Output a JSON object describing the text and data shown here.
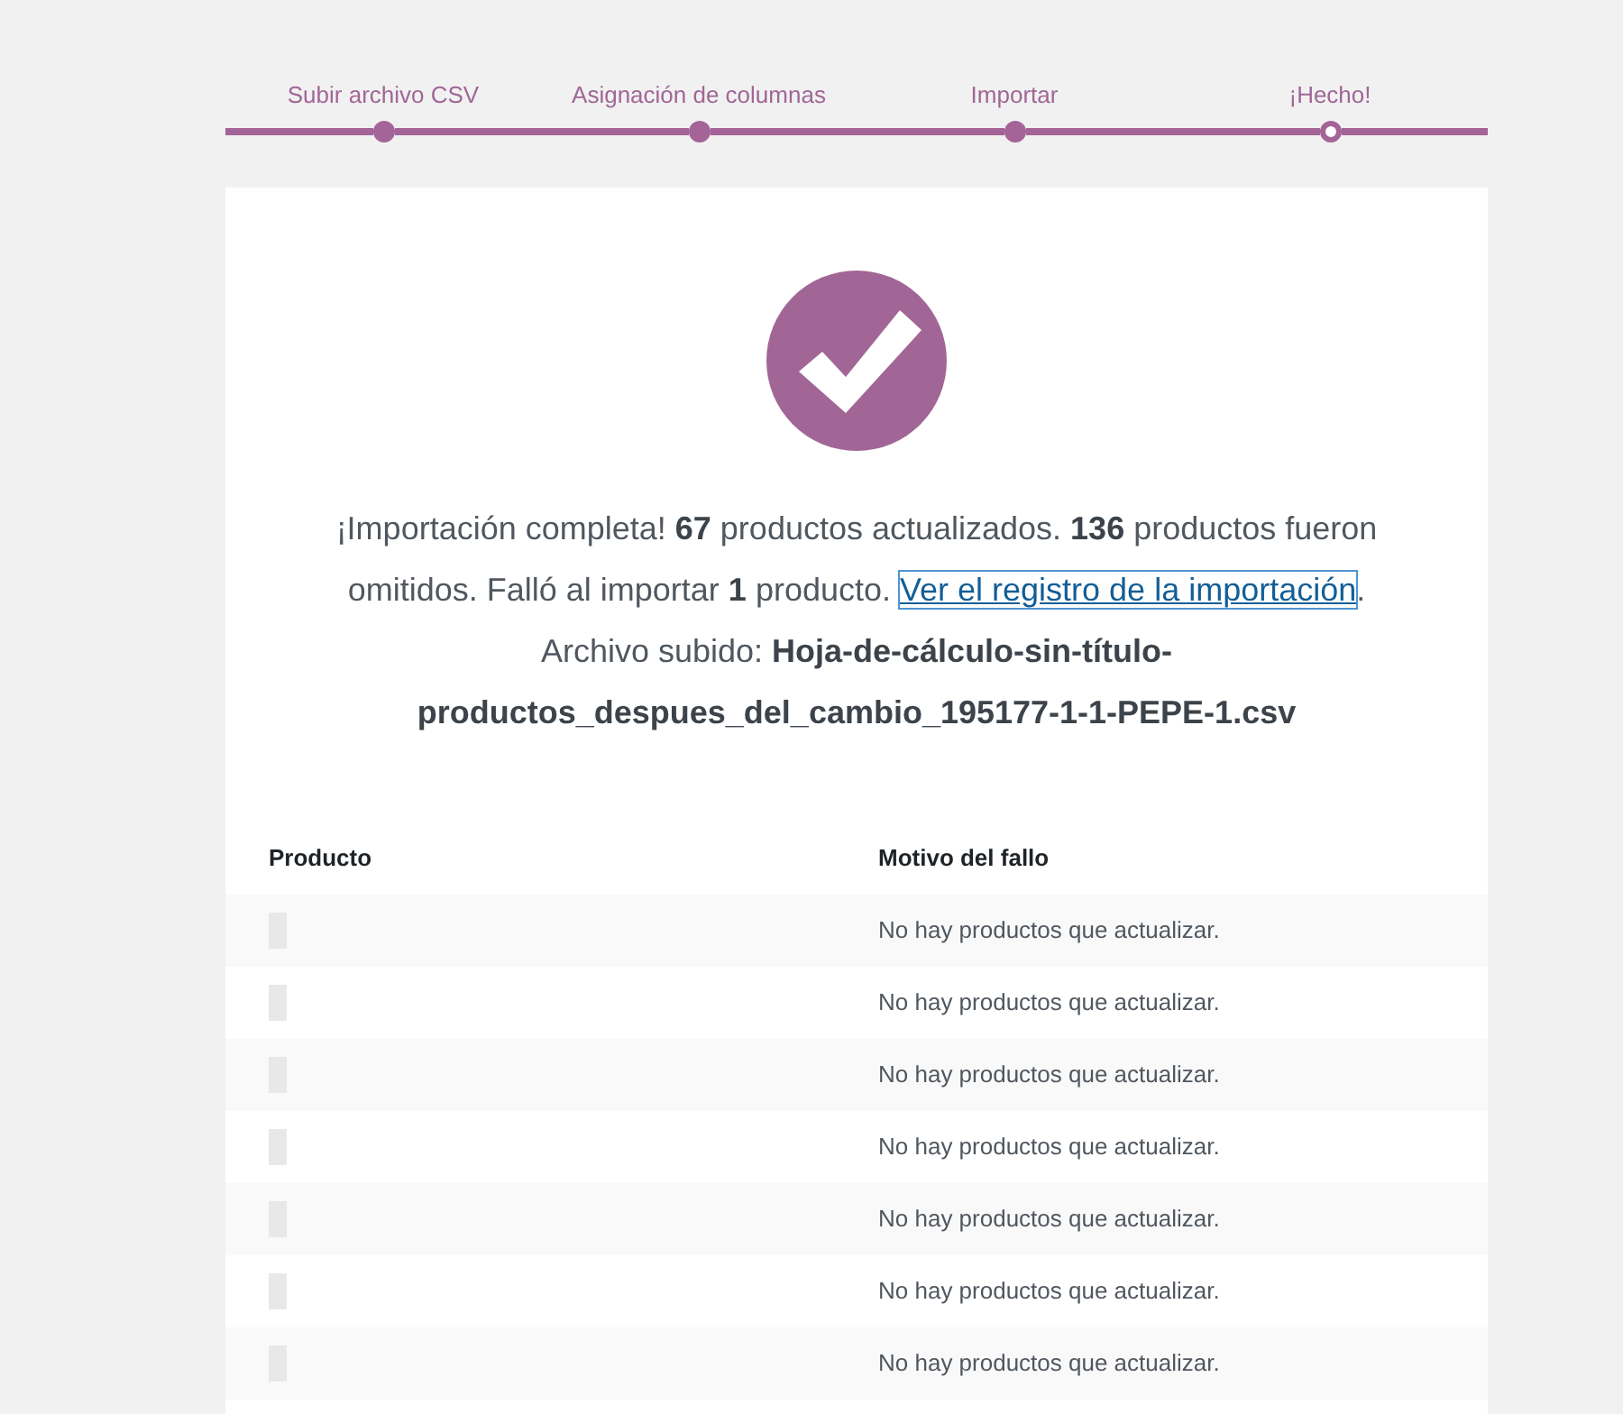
{
  "steps": [
    {
      "label": "Subir archivo CSV",
      "selected": false
    },
    {
      "label": "Asignación de columnas",
      "selected": false
    },
    {
      "label": "Importar",
      "selected": false
    },
    {
      "label": "¡Hecho!",
      "selected": true
    }
  ],
  "result": {
    "message": "¡Importación completa! **67** productos actualizados. **136** productos fueron omitidos. Falló al importar **1** producto.",
    "link": {
      "text": "Ver el registro de la importación",
      "focused": true
    },
    "link_suffix": ".",
    "file_label": "Archivo subido:",
    "file_name": "Hoja-de-cálculo-sin-título-productos_despues_del_cambio_195177-1-1-PEPE-1.csv"
  },
  "table": {
    "columns": [
      "Producto",
      "Motivo del fallo"
    ],
    "rows": [
      {
        "reason": "No hay productos que actualizar."
      },
      {
        "reason": "No hay productos que actualizar."
      },
      {
        "reason": "No hay productos que actualizar."
      },
      {
        "reason": "No hay productos que actualizar."
      },
      {
        "reason": "No hay productos que actualizar."
      },
      {
        "reason": "No hay productos que actualizar."
      },
      {
        "reason": "No hay productos que actualizar."
      }
    ]
  }
}
